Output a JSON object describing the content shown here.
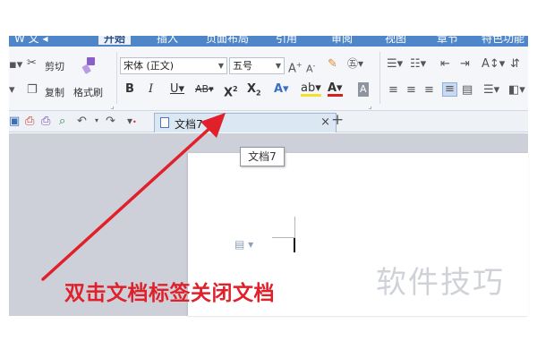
{
  "ribbon_tabs": [
    {
      "label": "开始",
      "active": true
    },
    {
      "label": "插入",
      "active": false
    },
    {
      "label": "页面布局",
      "active": false
    },
    {
      "label": "引用",
      "active": false
    },
    {
      "label": "审阅",
      "active": false
    },
    {
      "label": "视图",
      "active": false
    },
    {
      "label": "章节",
      "active": false
    },
    {
      "label": "特色功能",
      "active": false
    }
  ],
  "clipboard": {
    "cut_label": "剪切",
    "copy_label": "复制",
    "format_painter_label": "格式刷"
  },
  "font": {
    "family": "宋体 (正文)",
    "size": "五号"
  },
  "doc_tab": {
    "title": "文档7",
    "close_glyph": "×",
    "new_tab_glyph": "+"
  },
  "tooltip": {
    "text": "文档7"
  },
  "annotation": {
    "caption": "双击文档标签关闭文档",
    "arrow_color": "#e0202a"
  },
  "watermark": {
    "text": "软件技巧"
  },
  "colors": {
    "tab_bar": "#4e86c9",
    "workspace": "#cdd0d8",
    "accent_red": "#e0202a"
  }
}
